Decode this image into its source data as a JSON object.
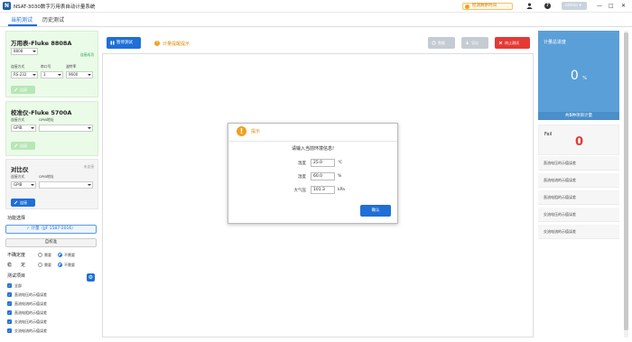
{
  "window": {
    "icon_text": "N",
    "title": "NSAT-3030数字万用表自动计量系统",
    "countdown": "检测剩余时间",
    "user": "admin",
    "buttons": {
      "minimize": "—",
      "maximize": "□",
      "close": "✕"
    }
  },
  "tabs": [
    {
      "label": "当前测试",
      "active": true
    },
    {
      "label": "历史测试",
      "active": false
    }
  ],
  "multimeter": {
    "title": "万用表-Fluke 8808A",
    "status": "连接成功",
    "model_select": "8808",
    "conn_label": "连接方式",
    "port_label": "串口号",
    "baud_label": "波特率",
    "conn_value": "RS-232",
    "port_value": "3",
    "baud_value": "9600",
    "connect_button": "连接"
  },
  "calibrator": {
    "title": "校准仪-Fluke 5700A",
    "status": "连接成功",
    "conn_label": "连接方式",
    "gpib_label": "GPIB地址",
    "conn_value": "GPIB",
    "gpib_value": "",
    "connect_button": "连接"
  },
  "comparator": {
    "title": "对比仪",
    "status": "未连接",
    "conn_label": "连接方式",
    "gpib_label": "GPIB地址",
    "conn_value": "GPIB",
    "gpib_value": "",
    "connect_button": "连接"
  },
  "function": {
    "label": "功能选择",
    "metering": "✓ 计量（JJF 1587-2016）",
    "self_cal": "自校准",
    "uncertainty_label": "不确定度",
    "stability_label": "稳　　定",
    "need": "需要",
    "no_need": "不需要",
    "uncertainty_selected": "no_need",
    "stability_selected": "no_need"
  },
  "test_items": {
    "label": "测试项目",
    "items": [
      "全部",
      "直流电压的示值误差",
      "直流电流的示值误差",
      "直流电阻的示值误差",
      "交流电压的示值误差",
      "交流电流的示值误差"
    ]
  },
  "toolbar": {
    "pause": "暂停测试",
    "hint": "计量提醒提示",
    "btn_a": "数据",
    "btn_b": "导出",
    "stop": "终止测试"
  },
  "dialog": {
    "title": "提示",
    "message": "请输入当前环境信息!",
    "fields": [
      {
        "label": "温度",
        "value": "25.0",
        "unit": "℃"
      },
      {
        "label": "湿度",
        "value": "60.0",
        "unit": "%"
      },
      {
        "label": "大气压",
        "value": "101.3",
        "unit": "kPa"
      }
    ],
    "ok": "确认"
  },
  "progress": {
    "title": "计量总进度",
    "value": "0",
    "unit": "%",
    "total_prefix": "共",
    "total_count": "5",
    "total_suffix": "种项目计量"
  },
  "fail": {
    "label": "Fail",
    "value": "0"
  },
  "result_items": [
    "直流电压的示值误差",
    "直流电流的示值误差",
    "直流电阻的示值误差",
    "交流电压的示值误差",
    "交流电流的示值误差"
  ],
  "colors": {
    "primary": "#1f6fd6",
    "success_bg": "#eafbe8",
    "danger": "#e53935",
    "warning": "#f0a020",
    "progress_bg": "#5b9fd8"
  }
}
